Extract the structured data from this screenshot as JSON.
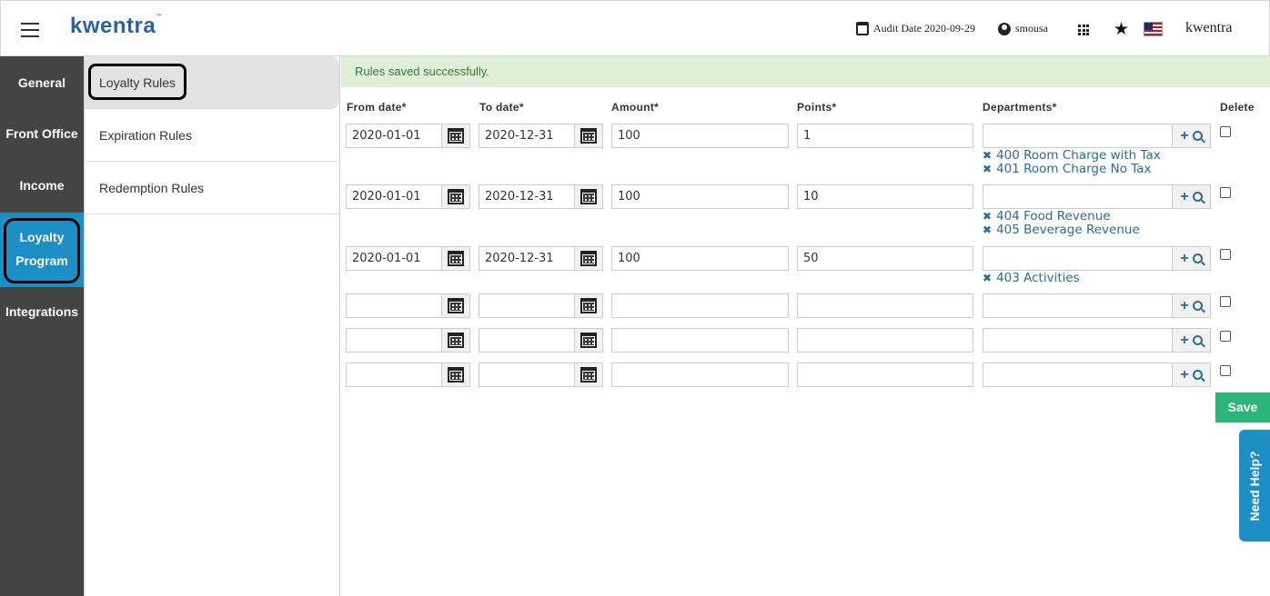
{
  "header": {
    "brand_logo": "kwentra",
    "audit_date": "Audit Date 2020-09-29",
    "user": "smousa",
    "brand_text": "kwentra",
    "icons": [
      "menu-icon",
      "calendar-icon",
      "user-icon",
      "apps-grid-icon",
      "star-icon",
      "us-flag-icon"
    ]
  },
  "sidebar": {
    "items": [
      {
        "label": "General"
      },
      {
        "label": "Front Office"
      },
      {
        "label": "Income"
      },
      {
        "label": "Loyalty",
        "label2": "Program"
      },
      {
        "label": "Integrations"
      }
    ]
  },
  "submenu": {
    "items": [
      {
        "label": "Loyalty Rules"
      },
      {
        "label": "Expiration Rules"
      },
      {
        "label": "Redemption Rules"
      }
    ]
  },
  "alert": "Rules saved successfully.",
  "columns": {
    "from": "From date*",
    "to": "To date*",
    "amount": "Amount*",
    "points": "Points*",
    "departments": "Departments*",
    "delete": "Delete"
  },
  "rows": [
    {
      "from": "2020-01-01",
      "to": "2020-12-31",
      "amount": "100",
      "points": "1",
      "departments": [
        "400 Room Charge with Tax",
        "401 Room Charge No Tax"
      ]
    },
    {
      "from": "2020-01-01",
      "to": "2020-12-31",
      "amount": "100",
      "points": "10",
      "departments": [
        "404 Food Revenue",
        "405 Beverage Revenue"
      ]
    },
    {
      "from": "2020-01-01",
      "to": "2020-12-31",
      "amount": "100",
      "points": "50",
      "departments": [
        "403 Activities"
      ]
    },
    {
      "from": "",
      "to": "",
      "amount": "",
      "points": "",
      "departments": []
    },
    {
      "from": "",
      "to": "",
      "amount": "",
      "points": "",
      "departments": []
    },
    {
      "from": "",
      "to": "",
      "amount": "",
      "points": "",
      "departments": []
    }
  ],
  "save_label": "Save",
  "help_label": "Need Help?",
  "colors": {
    "accent": "#1c8fc4",
    "link": "#2d6aa4",
    "save": "#2db47a",
    "alert_bg": "#dff0d8"
  }
}
